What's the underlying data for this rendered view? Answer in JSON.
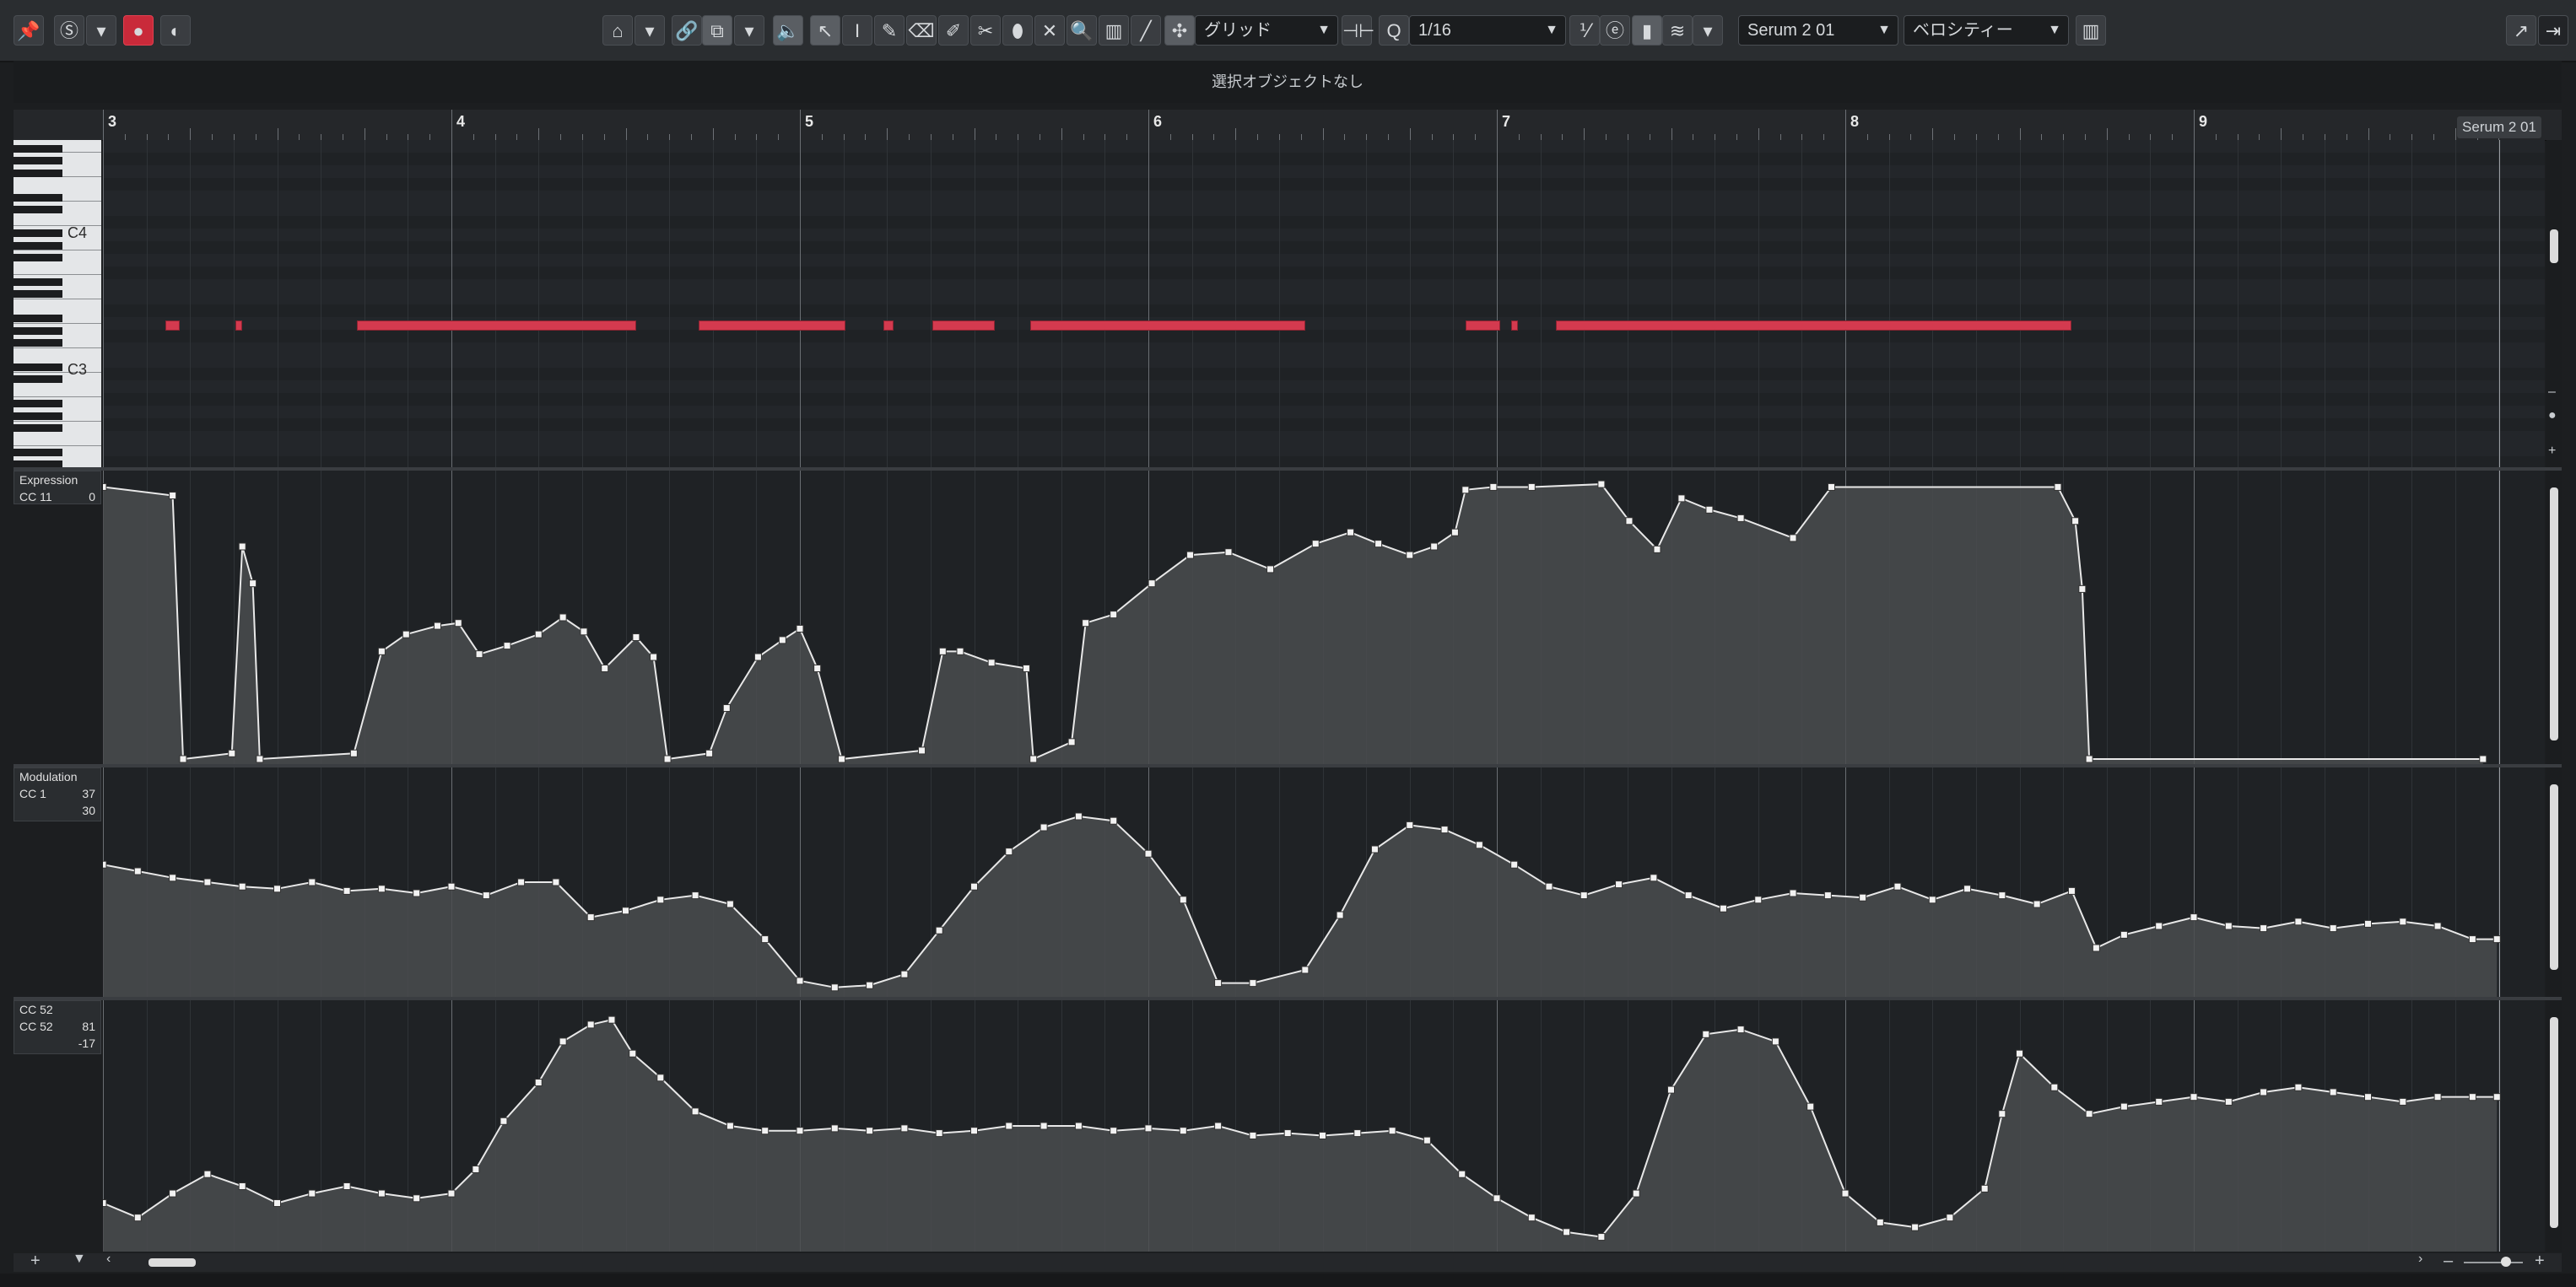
{
  "toolbar": {
    "grid_label": "グリッド",
    "quantize_label": "Q",
    "quantize_value": "1/16",
    "instrument": "Serum 2 01",
    "velocity": "ベロシティー",
    "icons": [
      "pin-icon",
      "solo-icon",
      "dropdown-icon",
      "record-icon",
      "monitor-icon",
      "home-icon",
      "link-icon",
      "stack-icon",
      "speaker-icon",
      "pointer-icon",
      "range-icon",
      "pencil-icon",
      "eraser-icon",
      "brush-icon",
      "scissors-icon",
      "glue-icon",
      "mute-x-icon",
      "zoom-icon",
      "velocity-icon",
      "line-icon",
      "snap-icon",
      "grid-type-icon",
      "quantize-icon",
      "iterative-icon",
      "e-icon",
      "step-icon",
      "layers-icon",
      "keyboard-icon",
      "export-icon",
      "close-icon"
    ]
  },
  "info_line": {
    "text": "選択オブジェクトなし"
  },
  "ruler": {
    "bars": [
      "3",
      "4",
      "5",
      "6",
      "7",
      "8",
      "9"
    ],
    "track_label": "Serum 2 01"
  },
  "keyboard": {
    "labels": [
      "C4",
      "C3"
    ]
  },
  "notes": [
    {
      "start": 3.18,
      "end": 3.22
    },
    {
      "start": 3.38,
      "end": 3.4
    },
    {
      "start": 3.73,
      "end": 4.53
    },
    {
      "start": 4.71,
      "end": 5.13
    },
    {
      "start": 5.24,
      "end": 5.27
    },
    {
      "start": 5.38,
      "end": 5.56
    },
    {
      "start": 5.66,
      "end": 6.45
    },
    {
      "start": 6.91,
      "end": 7.01
    },
    {
      "start": 7.04,
      "end": 7.06
    },
    {
      "start": 7.17,
      "end": 8.65
    }
  ],
  "lanes": [
    {
      "name": "Expression",
      "cc": "CC 11",
      "value": "0",
      "extra": "",
      "points": [
        [
          3.0,
          0.96
        ],
        [
          3.2,
          0.93
        ],
        [
          3.23,
          0.0
        ],
        [
          3.37,
          0.02
        ],
        [
          3.4,
          0.75
        ],
        [
          3.43,
          0.62
        ],
        [
          3.45,
          0.0
        ],
        [
          3.72,
          0.02
        ],
        [
          3.8,
          0.38
        ],
        [
          3.87,
          0.44
        ],
        [
          3.96,
          0.47
        ],
        [
          4.02,
          0.48
        ],
        [
          4.08,
          0.37
        ],
        [
          4.16,
          0.4
        ],
        [
          4.25,
          0.44
        ],
        [
          4.32,
          0.5
        ],
        [
          4.38,
          0.45
        ],
        [
          4.44,
          0.32
        ],
        [
          4.53,
          0.43
        ],
        [
          4.58,
          0.36
        ],
        [
          4.62,
          0.0
        ],
        [
          4.74,
          0.02
        ],
        [
          4.79,
          0.18
        ],
        [
          4.88,
          0.36
        ],
        [
          4.95,
          0.42
        ],
        [
          5.0,
          0.46
        ],
        [
          5.05,
          0.32
        ],
        [
          5.12,
          0.0
        ],
        [
          5.35,
          0.03
        ],
        [
          5.41,
          0.38
        ],
        [
          5.46,
          0.38
        ],
        [
          5.55,
          0.34
        ],
        [
          5.65,
          0.32
        ],
        [
          5.67,
          0.0
        ],
        [
          5.78,
          0.06
        ],
        [
          5.82,
          0.48
        ],
        [
          5.9,
          0.51
        ],
        [
          6.01,
          0.62
        ],
        [
          6.12,
          0.72
        ],
        [
          6.23,
          0.73
        ],
        [
          6.35,
          0.67
        ],
        [
          6.48,
          0.76
        ],
        [
          6.58,
          0.8
        ],
        [
          6.66,
          0.76
        ],
        [
          6.75,
          0.72
        ],
        [
          6.82,
          0.75
        ],
        [
          6.88,
          0.8
        ],
        [
          6.91,
          0.95
        ],
        [
          6.99,
          0.96
        ],
        [
          7.1,
          0.96
        ],
        [
          7.3,
          0.97
        ],
        [
          7.38,
          0.84
        ],
        [
          7.46,
          0.74
        ],
        [
          7.53,
          0.92
        ],
        [
          7.61,
          0.88
        ],
        [
          7.7,
          0.85
        ],
        [
          7.85,
          0.78
        ],
        [
          7.96,
          0.96
        ],
        [
          8.61,
          0.96
        ],
        [
          8.66,
          0.84
        ],
        [
          8.68,
          0.6
        ],
        [
          8.7,
          0.0
        ],
        [
          9.83,
          0.0
        ]
      ]
    },
    {
      "name": "Modulation",
      "cc": "CC 1",
      "value": "37",
      "extra": "30",
      "points": [
        [
          3.0,
          0.58
        ],
        [
          3.1,
          0.55
        ],
        [
          3.2,
          0.52
        ],
        [
          3.3,
          0.5
        ],
        [
          3.4,
          0.48
        ],
        [
          3.5,
          0.47
        ],
        [
          3.6,
          0.5
        ],
        [
          3.7,
          0.46
        ],
        [
          3.8,
          0.47
        ],
        [
          3.9,
          0.45
        ],
        [
          4.0,
          0.48
        ],
        [
          4.1,
          0.44
        ],
        [
          4.2,
          0.5
        ],
        [
          4.3,
          0.5
        ],
        [
          4.4,
          0.34
        ],
        [
          4.5,
          0.37
        ],
        [
          4.6,
          0.42
        ],
        [
          4.7,
          0.44
        ],
        [
          4.8,
          0.4
        ],
        [
          4.9,
          0.24
        ],
        [
          5.0,
          0.05
        ],
        [
          5.1,
          0.02
        ],
        [
          5.2,
          0.03
        ],
        [
          5.3,
          0.08
        ],
        [
          5.4,
          0.28
        ],
        [
          5.5,
          0.48
        ],
        [
          5.6,
          0.64
        ],
        [
          5.7,
          0.75
        ],
        [
          5.8,
          0.8
        ],
        [
          5.9,
          0.78
        ],
        [
          6.0,
          0.63
        ],
        [
          6.1,
          0.42
        ],
        [
          6.2,
          0.04
        ],
        [
          6.3,
          0.04
        ],
        [
          6.45,
          0.1
        ],
        [
          6.55,
          0.35
        ],
        [
          6.65,
          0.65
        ],
        [
          6.75,
          0.76
        ],
        [
          6.85,
          0.74
        ],
        [
          6.95,
          0.67
        ],
        [
          7.05,
          0.58
        ],
        [
          7.15,
          0.48
        ],
        [
          7.25,
          0.44
        ],
        [
          7.35,
          0.49
        ],
        [
          7.45,
          0.52
        ],
        [
          7.55,
          0.44
        ],
        [
          7.65,
          0.38
        ],
        [
          7.75,
          0.42
        ],
        [
          7.85,
          0.45
        ],
        [
          7.95,
          0.44
        ],
        [
          8.05,
          0.43
        ],
        [
          8.15,
          0.48
        ],
        [
          8.25,
          0.42
        ],
        [
          8.35,
          0.47
        ],
        [
          8.45,
          0.44
        ],
        [
          8.55,
          0.4
        ],
        [
          8.65,
          0.46
        ],
        [
          8.72,
          0.2
        ],
        [
          8.8,
          0.26
        ],
        [
          8.9,
          0.3
        ],
        [
          9.0,
          0.34
        ],
        [
          9.1,
          0.3
        ],
        [
          9.2,
          0.29
        ],
        [
          9.3,
          0.32
        ],
        [
          9.4,
          0.29
        ],
        [
          9.5,
          0.31
        ],
        [
          9.6,
          0.32
        ],
        [
          9.7,
          0.3
        ],
        [
          9.8,
          0.24
        ],
        [
          9.87,
          0.24
        ]
      ]
    },
    {
      "name": "CC 52",
      "cc": "CC 52",
      "value": "81",
      "extra": "-17",
      "points": [
        [
          3.0,
          0.18
        ],
        [
          3.1,
          0.12
        ],
        [
          3.2,
          0.22
        ],
        [
          3.3,
          0.3
        ],
        [
          3.4,
          0.25
        ],
        [
          3.5,
          0.18
        ],
        [
          3.6,
          0.22
        ],
        [
          3.7,
          0.25
        ],
        [
          3.8,
          0.22
        ],
        [
          3.9,
          0.2
        ],
        [
          4.0,
          0.22
        ],
        [
          4.07,
          0.32
        ],
        [
          4.15,
          0.52
        ],
        [
          4.25,
          0.68
        ],
        [
          4.32,
          0.85
        ],
        [
          4.4,
          0.92
        ],
        [
          4.46,
          0.94
        ],
        [
          4.52,
          0.8
        ],
        [
          4.6,
          0.7
        ],
        [
          4.7,
          0.56
        ],
        [
          4.8,
          0.5
        ],
        [
          4.9,
          0.48
        ],
        [
          5.0,
          0.48
        ],
        [
          5.1,
          0.49
        ],
        [
          5.2,
          0.48
        ],
        [
          5.3,
          0.49
        ],
        [
          5.4,
          0.47
        ],
        [
          5.5,
          0.48
        ],
        [
          5.6,
          0.5
        ],
        [
          5.7,
          0.5
        ],
        [
          5.8,
          0.5
        ],
        [
          5.9,
          0.48
        ],
        [
          6.0,
          0.49
        ],
        [
          6.1,
          0.48
        ],
        [
          6.2,
          0.5
        ],
        [
          6.3,
          0.46
        ],
        [
          6.4,
          0.47
        ],
        [
          6.5,
          0.46
        ],
        [
          6.6,
          0.47
        ],
        [
          6.7,
          0.48
        ],
        [
          6.8,
          0.44
        ],
        [
          6.9,
          0.3
        ],
        [
          7.0,
          0.2
        ],
        [
          7.1,
          0.12
        ],
        [
          7.2,
          0.06
        ],
        [
          7.3,
          0.04
        ],
        [
          7.4,
          0.22
        ],
        [
          7.5,
          0.65
        ],
        [
          7.6,
          0.88
        ],
        [
          7.7,
          0.9
        ],
        [
          7.8,
          0.85
        ],
        [
          7.9,
          0.58
        ],
        [
          8.0,
          0.22
        ],
        [
          8.1,
          0.1
        ],
        [
          8.2,
          0.08
        ],
        [
          8.3,
          0.12
        ],
        [
          8.4,
          0.24
        ],
        [
          8.45,
          0.55
        ],
        [
          8.5,
          0.8
        ],
        [
          8.6,
          0.66
        ],
        [
          8.7,
          0.55
        ],
        [
          8.8,
          0.58
        ],
        [
          8.9,
          0.6
        ],
        [
          9.0,
          0.62
        ],
        [
          9.1,
          0.6
        ],
        [
          9.2,
          0.64
        ],
        [
          9.3,
          0.66
        ],
        [
          9.4,
          0.64
        ],
        [
          9.5,
          0.62
        ],
        [
          9.6,
          0.6
        ],
        [
          9.7,
          0.62
        ],
        [
          9.8,
          0.62
        ],
        [
          9.87,
          0.62
        ]
      ]
    }
  ]
}
